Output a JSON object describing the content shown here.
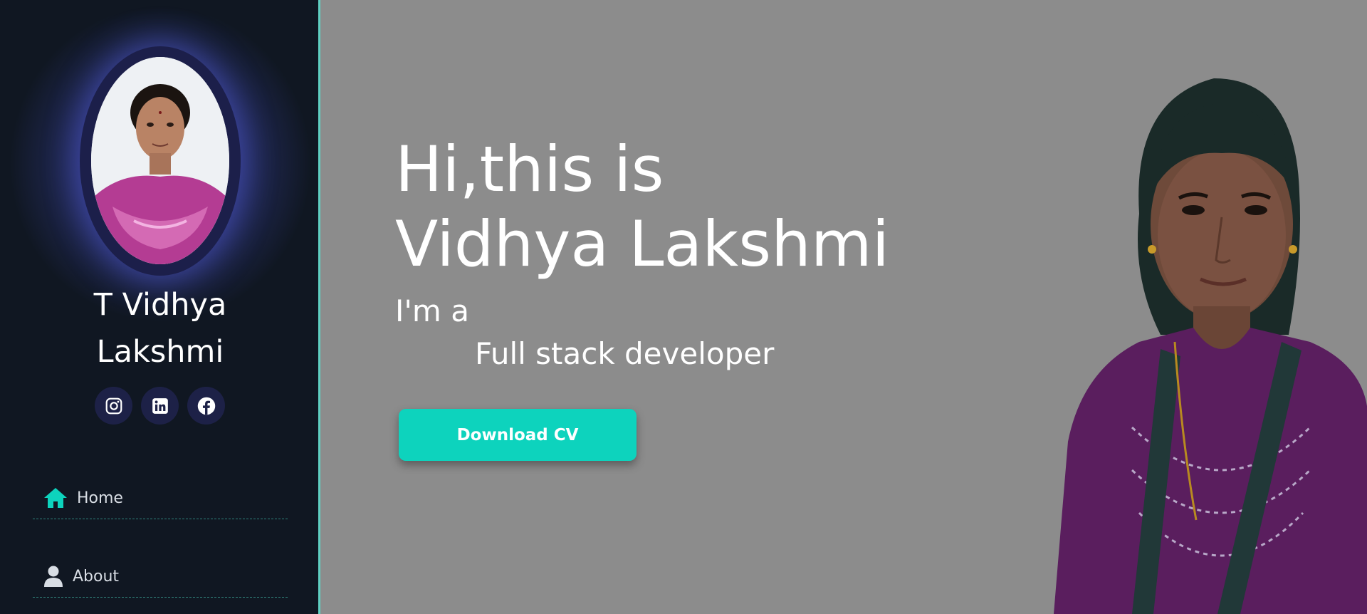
{
  "sidebar": {
    "name_line1": "T Vidhya",
    "name_line2": "Lakshmi",
    "socials": [
      {
        "icon": "instagram-icon"
      },
      {
        "icon": "linkedin-icon"
      },
      {
        "icon": "facebook-icon"
      }
    ],
    "nav": [
      {
        "label": "Home",
        "icon": "home-icon",
        "active": true
      },
      {
        "label": "About",
        "icon": "user-icon",
        "active": false
      }
    ]
  },
  "hero": {
    "title_line1": "Hi,this is",
    "title_line2": "Vidhya Lakshmi",
    "intro": "I'm a",
    "role": "Full stack developer",
    "button_label": "Download CV"
  },
  "colors": {
    "accent": "#0dd3bd",
    "sidebar_bg": "#101722",
    "main_bg": "#8c8c8c",
    "social_bg": "#1d2147",
    "nav_active_icon": "#0dd3bd"
  }
}
